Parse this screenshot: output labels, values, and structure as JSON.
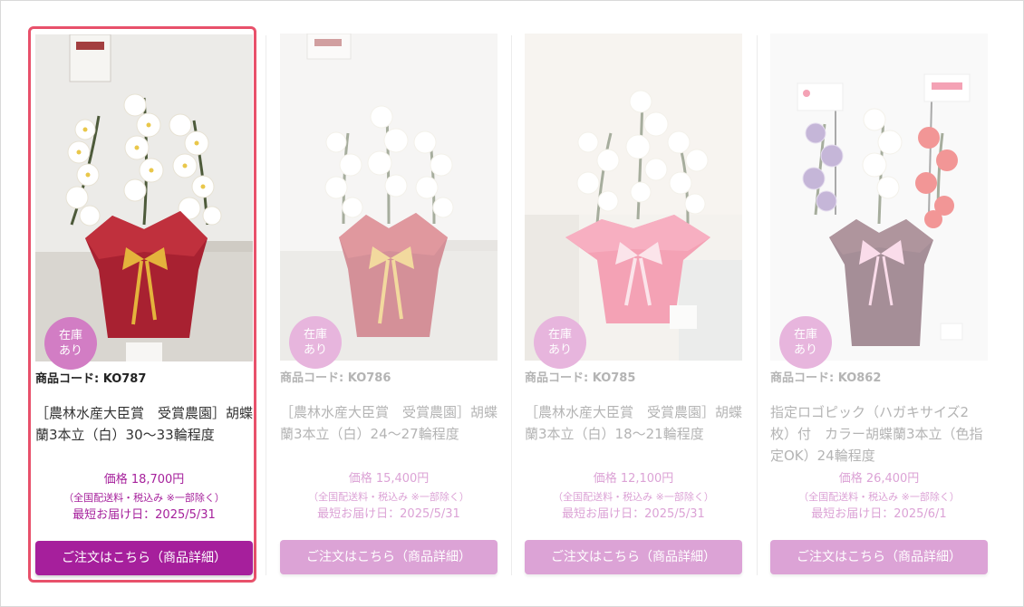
{
  "products": [
    {
      "stock_badge": [
        "在庫",
        "あり"
      ],
      "code": "商品コード: KO787",
      "title": "［農林水産大臣賞　受賞農園］胡蝶蘭3本立（白）30〜33輪程度",
      "price": "価格 18,700円",
      "shipping_note": "（全国配送料・税込み ※一部除く）",
      "delivery": "最短お届け日：2025/5/31",
      "button": "ご注文はこちら（商品詳細）"
    },
    {
      "stock_badge": [
        "在庫",
        "あり"
      ],
      "code": "商品コード: KO786",
      "title": "［農林水産大臣賞　受賞農園］胡蝶蘭3本立（白）24〜27輪程度",
      "price": "価格 15,400円",
      "shipping_note": "（全国配送料・税込み ※一部除く）",
      "delivery": "最短お届け日：2025/5/31",
      "button": "ご注文はこちら（商品詳細）"
    },
    {
      "stock_badge": [
        "在庫",
        "あり"
      ],
      "code": "商品コード: KO785",
      "title": "［農林水産大臣賞　受賞農園］胡蝶蘭3本立（白）18〜21輪程度",
      "price": "価格 12,100円",
      "shipping_note": "（全国配送料・税込み ※一部除く）",
      "delivery": "最短お届け日：2025/5/31",
      "button": "ご注文はこちら（商品詳細）"
    },
    {
      "stock_badge": [
        "在庫",
        "あり"
      ],
      "code": "商品コード: KO862",
      "title": "指定ロゴピック（ハガキサイズ2枚）付　カラー胡蝶蘭3本立（色指定OK）24輪程度",
      "price": "価格 26,400円",
      "shipping_note": "（全国配送料・税込み ※一部除く）",
      "delivery": "最短お届け日：2025/6/1",
      "button": "ご注文はこちら（商品詳細）"
    }
  ],
  "colors": {
    "accent": "#a61f9c",
    "accent_light": "#dca3d6",
    "highlight_border": "#e8516b"
  }
}
